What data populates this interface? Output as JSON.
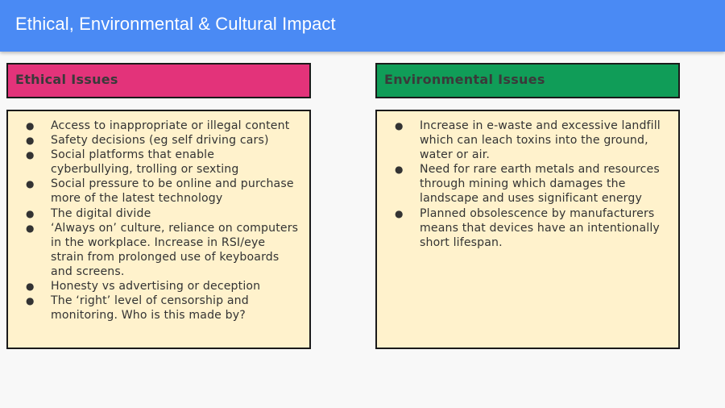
{
  "title": "Ethical, Environmental & Cultural Impact",
  "ethical": {
    "heading": "Ethical Issues",
    "color": "#e3337a",
    "items": [
      "Access to inappropriate or illegal content",
      "Safety decisions (eg self driving cars)",
      "Social platforms that enable cyberbullying, trolling or sexting",
      "Social pressure to be online and purchase more of the latest technology",
      "The digital divide",
      "‘Always on’ culture, reliance on computers in the workplace. Increase in RSI/eye strain from prolonged use of keyboards and screens.",
      "Honesty vs advertising or deception",
      "The ‘right’ level of censorship and monitoring. Who is this made by?"
    ]
  },
  "environmental": {
    "heading": "Environmental Issues",
    "color": "#109d58",
    "items": [
      "Increase in e-waste and excessive landfill which can leach toxins into the ground, water or air.",
      "Need for rare earth metals and resources through mining which damages the landscape and uses significant energy",
      "Planned obsolescence by manufacturers means that devices have an intentionally short lifespan."
    ]
  },
  "bullet_glyph": "●",
  "colors": {
    "title_bar": "#4a8af4",
    "body_fill": "#fff2cc"
  }
}
